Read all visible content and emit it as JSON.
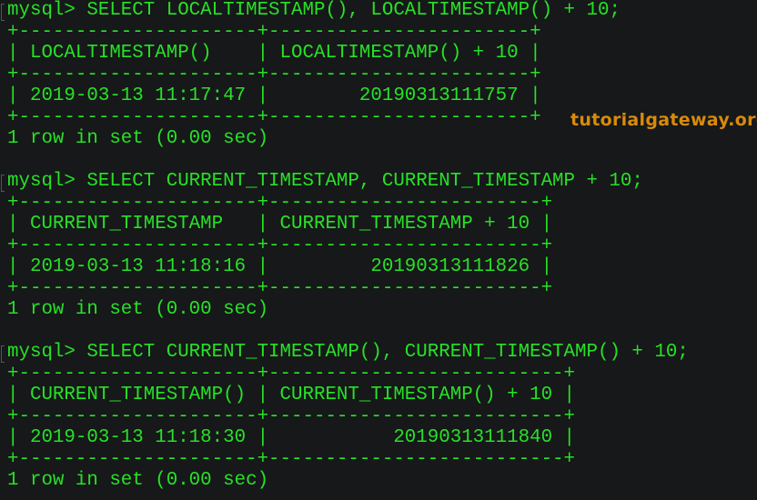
{
  "terminal": {
    "blocks": [
      {
        "command": "mysql> SELECT LOCALTIMESTAMP(), LOCALTIMESTAMP() + 10;",
        "border": "+---------------------+-----------------------+",
        "header": "| LOCALTIMESTAMP()    | LOCALTIMESTAMP() + 10 |",
        "row": "| 2019-03-13 11:17:47 |        20190313111757 |",
        "status": "1 row in set (0.00 sec)"
      },
      {
        "command": "mysql> SELECT CURRENT_TIMESTAMP, CURRENT_TIMESTAMP + 10;",
        "border": "+---------------------+------------------------+",
        "header": "| CURRENT_TIMESTAMP   | CURRENT_TIMESTAMP + 10 |",
        "row": "| 2019-03-13 11:18:16 |         20190313111826 |",
        "status": "1 row in set (0.00 sec)"
      },
      {
        "command": "mysql> SELECT CURRENT_TIMESTAMP(), CURRENT_TIMESTAMP() + 10;",
        "border": "+---------------------+--------------------------+",
        "header": "| CURRENT_TIMESTAMP() | CURRENT_TIMESTAMP() + 10 |",
        "row": "| 2019-03-13 11:18:30 |           20190313111840 |",
        "status": "1 row in set (0.00 sec)"
      }
    ]
  },
  "watermark": "tutorialgateway.org"
}
